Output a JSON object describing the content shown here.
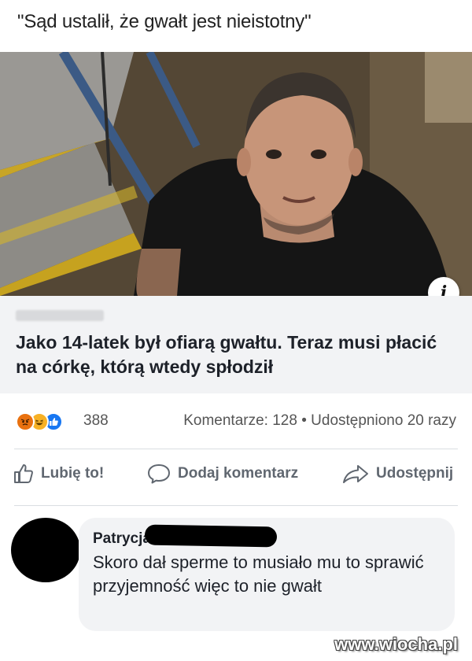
{
  "header": {
    "quote": "\"Sąd ustalił, że gwałt jest nieistotny\""
  },
  "link_preview": {
    "info_icon": "info-icon",
    "title": "Jako 14-latek był ofiarą gwałtu. Teraz musi płacić na córkę, którą wtedy spłodził"
  },
  "stats": {
    "reaction_icons": [
      "angry-reaction-icon",
      "haha-reaction-icon",
      "like-reaction-icon"
    ],
    "reactions_count": "388",
    "comments": "Komentarze: 128",
    "separator": "•",
    "shares": "Udostępniono 20 razy"
  },
  "actions": {
    "like": {
      "label": "Lubię to!",
      "icon": "thumbs-up-icon"
    },
    "comment": {
      "label": "Dodaj komentarz",
      "icon": "comment-icon"
    },
    "share": {
      "label": "Udostępnij",
      "icon": "share-arrow-icon"
    }
  },
  "comment": {
    "author": "Patrycja",
    "text": "Skoro dał sperme to musiało mu to sprawić przyjemność więc to nie gwałt"
  },
  "watermark": "www.wiocha.pl"
}
